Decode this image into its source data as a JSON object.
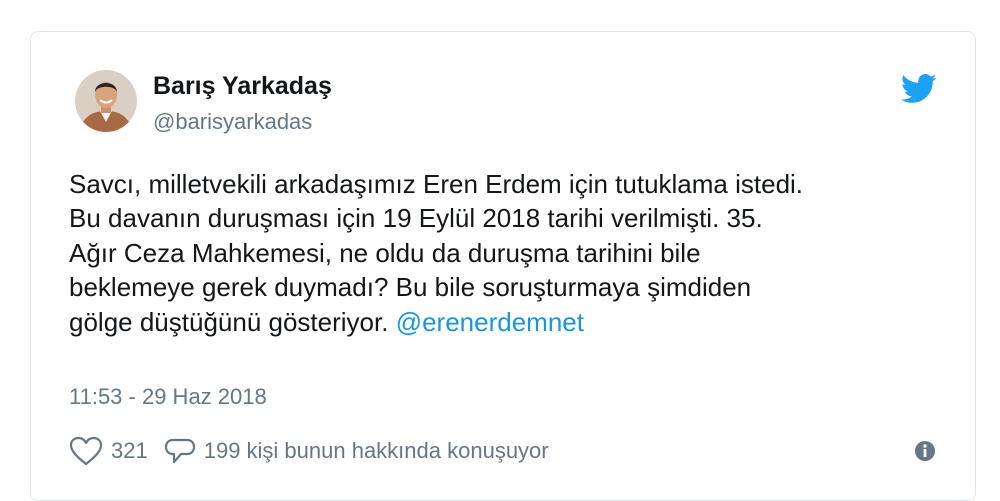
{
  "author": {
    "display_name": "Barış Yarkadaş",
    "screen_name": "@barisyarkadas",
    "avatar_icon": "avatar-photo"
  },
  "tweet": {
    "lines": [
      "Savcı, milletvekili arkadaşımız Eren Erdem için tutuklama istedi.",
      "Bu davanın duruşması için 19 Eylül 2018 tarihi verilmişti. 35.",
      "Ağır Ceza Mahkemesi, ne oldu da duruşma tarihini bile",
      "beklemeye gerek duymadı? Bu bile soruşturmaya şimdiden",
      "gölge düştüğünü gösteriyor."
    ],
    "mention": "@erenerdemnet",
    "timestamp": "11:53 - 29 Haz 2018"
  },
  "actions": {
    "like_icon": "heart-icon",
    "like_count": "321",
    "reply_icon": "speech-bubble-icon",
    "conversation_text": "199 kişi bunun hakkında konuşuyor",
    "info_icon": "info-icon"
  },
  "colors": {
    "text": "#14171a",
    "muted": "#657786",
    "link": "#1b95e0",
    "twitter_blue": "#1da1f2",
    "border": "#e1e8ed"
  }
}
